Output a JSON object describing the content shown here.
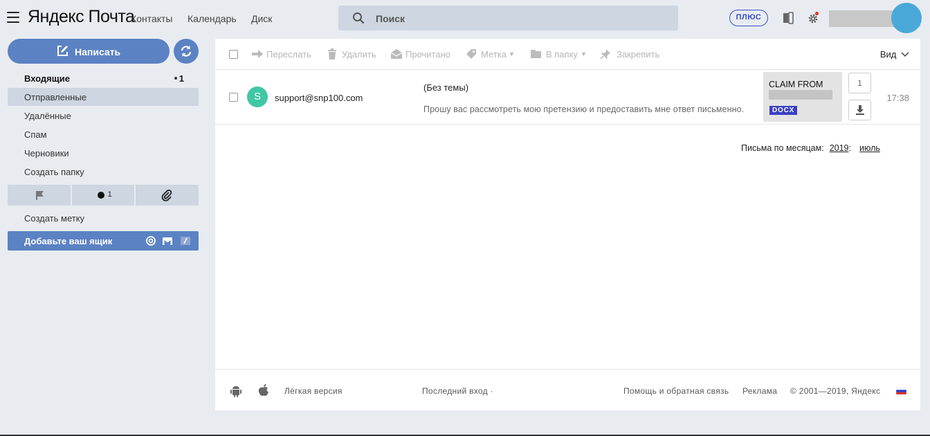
{
  "header": {
    "logo_yandex": "Яндекс",
    "logo_mail": "Почта",
    "nav": [
      "Контакты",
      "Календарь",
      "Диск"
    ],
    "search_placeholder": "Поиск",
    "plus_label": "ПЛЮС"
  },
  "sidebar": {
    "compose_label": "Написать",
    "folders": [
      {
        "label": "Входящие",
        "count": "1"
      },
      {
        "label": "Отправленные"
      },
      {
        "label": "Удалённые"
      },
      {
        "label": "Спам"
      },
      {
        "label": "Черновики"
      },
      {
        "label": "Создать папку"
      }
    ],
    "unread_filter_count": "1",
    "create_label": "Создать метку",
    "add_mailbox": "Добавьте ваш ящик"
  },
  "toolbar": {
    "forward": "Переслать",
    "delete": "Удалить",
    "read": "Прочитано",
    "label": "Метка",
    "to_folder": "В папку",
    "pin": "Закрепить",
    "view": "Вид"
  },
  "messages": [
    {
      "avatar_letter": "S",
      "sender": "support@snp100.com",
      "subject": "(Без темы)",
      "snippet": "Прошу вас рассмотреть мою претензию и предоставить мне ответ письменно.",
      "attachment_name": "CLAIM FROM",
      "attachment_type": "DOCX",
      "attachment_count": "1",
      "time": "17:38"
    }
  ],
  "archive": {
    "label": "Письма по месяцам:",
    "year": "2019",
    "year_suffix": ":",
    "month": "июль"
  },
  "footer": {
    "light_version": "Лёгкая версия",
    "last_login": "Последний вход ·",
    "help": "Помощь и обратная связь",
    "ads": "Реклама",
    "copyright": "© 2001—2019, Яндекс"
  },
  "colors": {
    "accent": "#5b82c3",
    "sidebar_active": "#cdd6e1",
    "avatar": "#3fc7a6",
    "badge": "#3a3fc4"
  }
}
